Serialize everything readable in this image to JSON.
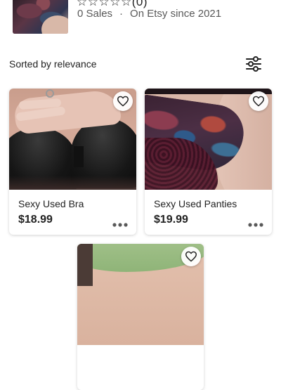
{
  "shop": {
    "rating_stars": "☆☆☆☆☆",
    "review_count": "(0)",
    "sales": "0 Sales",
    "separator": "·",
    "since": "On Etsy since 2021"
  },
  "listing_controls": {
    "sort_label": "Sorted by relevance",
    "filter_icon": "sliders-icon"
  },
  "products": [
    {
      "title": "Sexy Used Bra",
      "price": "$18.99",
      "favorite_icon": "heart-outline-icon",
      "more_icon": "more-dots-icon"
    },
    {
      "title": "Sexy Used Panties",
      "price": "$19.99",
      "favorite_icon": "heart-outline-icon",
      "more_icon": "more-dots-icon"
    },
    {
      "title": "",
      "price": "",
      "favorite_icon": "heart-outline-icon"
    }
  ],
  "colors": {
    "text_primary": "#222222",
    "text_secondary": "#595959",
    "card_background": "#ffffff"
  }
}
